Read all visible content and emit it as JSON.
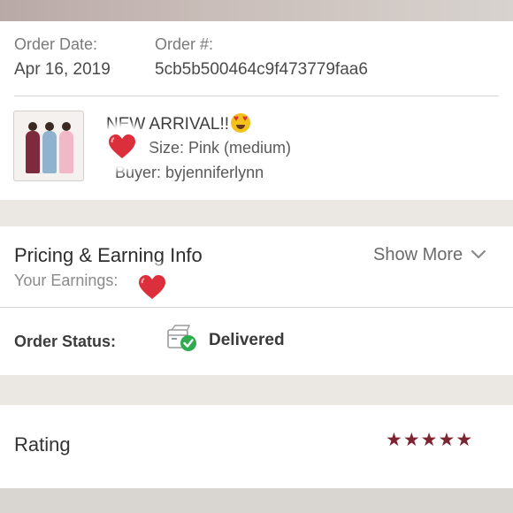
{
  "order": {
    "date_label": "Order Date:",
    "date_value": "Apr 16, 2019",
    "number_label": "Order #:",
    "number_value": "5cb5b500464c9f473779faa6"
  },
  "item": {
    "title": "NEW ARRIVAL!!",
    "title_emoji": "heart-eyes-emoji",
    "size_text": "Size: Pink (medium)",
    "buyer_text": "Buyer: byjenniferlynn"
  },
  "pricing": {
    "title": "Pricing & Earning Info",
    "earnings_label": "Your Earnings:",
    "show_more_label": "Show More",
    "show_more_icon": "chevron-down-icon"
  },
  "status": {
    "label": "Order Status:",
    "value": "Delivered",
    "icon": "delivered-box-icon",
    "icon_check_color": "#2eac4f"
  },
  "rating": {
    "label": "Rating",
    "stars": 5,
    "max_stars": 5,
    "star_color": "#7d2431"
  },
  "stickers": {
    "heart_color": "#dc2f3c"
  }
}
